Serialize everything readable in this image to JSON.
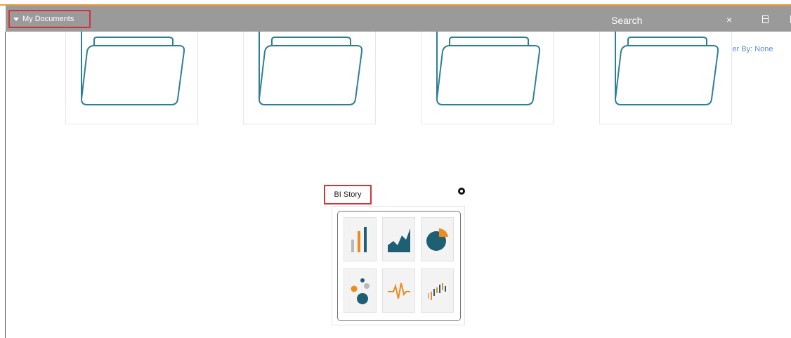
{
  "header": {
    "my_documents_label": "My Documents",
    "search_placeholder": "Search",
    "close_symbol": "×",
    "order_by_label": "ler By: None"
  },
  "folders": [
    {
      "name": "folder-1"
    },
    {
      "name": "folder-2"
    },
    {
      "name": "folder-3"
    },
    {
      "name": "folder-4"
    }
  ],
  "story": {
    "title": "BI Story",
    "tiles": [
      "bar-chart-icon",
      "area-chart-icon",
      "pie-chart-icon",
      "bubble-chart-icon",
      "line-chart-icon",
      "mixed-bar-chart-icon"
    ]
  },
  "colors": {
    "accent": "#f39c34",
    "header_bg": "#9a9a9a",
    "highlight_border": "#d0343a",
    "folder_stroke": "#2f7f94",
    "chart_teal": "#1f5f74",
    "chart_orange": "#ef8a1e",
    "chart_gray": "#b9b9b9",
    "link_blue": "#5b8fd6"
  }
}
